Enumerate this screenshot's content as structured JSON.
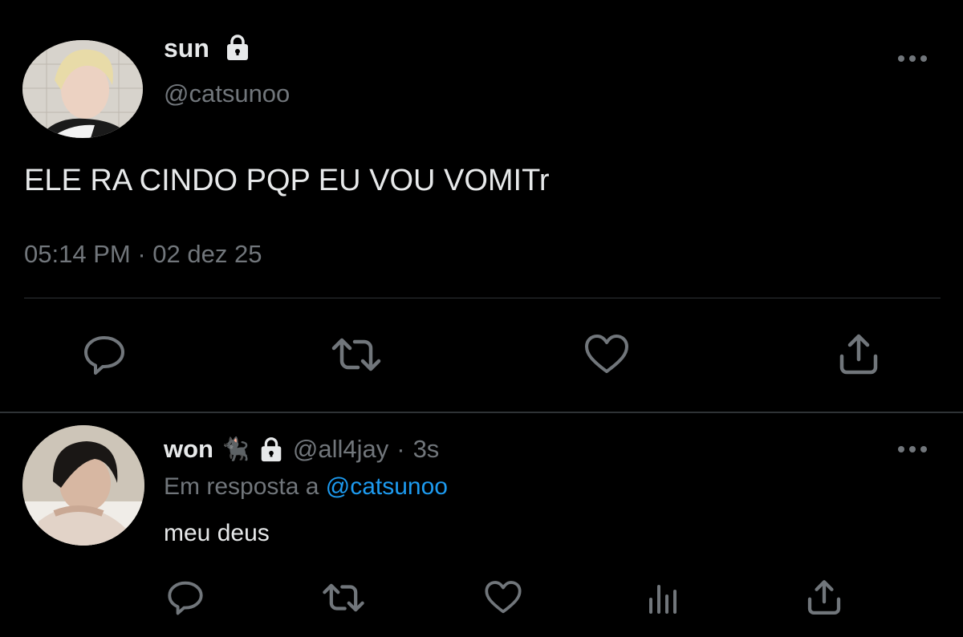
{
  "main_tweet": {
    "author": {
      "display_name": "sun",
      "handle": "@catsunoo",
      "avatar": "avatar-photo-blond",
      "locked_icon": "lock-icon"
    },
    "text": "ELE RA CINDO PQP EU VOU VOMITr",
    "time": "05:14 PM",
    "separator": "·",
    "date": "02 dez 25",
    "more_icon": "more-horizontal-icon",
    "actions": [
      {
        "icon": "reply-icon"
      },
      {
        "icon": "retweet-icon"
      },
      {
        "icon": "like-icon"
      },
      {
        "icon": "share-icon"
      }
    ]
  },
  "reply": {
    "author": {
      "display_name": "won",
      "emoji": "🐈‍⬛",
      "handle": "@all4jay",
      "avatar": "avatar-photo-dark-hair",
      "locked_icon": "lock-icon"
    },
    "separator": "·",
    "age": "3s",
    "reply_prefix": "Em resposta a",
    "reply_mention": "@catsunoo",
    "text": "meu deus",
    "more_icon": "more-horizontal-icon",
    "actions": [
      {
        "icon": "reply-icon"
      },
      {
        "icon": "retweet-icon"
      },
      {
        "icon": "like-icon"
      },
      {
        "icon": "analytics-icon"
      },
      {
        "icon": "share-icon"
      }
    ]
  },
  "colors": {
    "background": "#000000",
    "primary_text": "#e7e9ea",
    "secondary_text": "#71767b",
    "link": "#1d9bf0",
    "divider": "#2f3336",
    "icon": "#71767b"
  }
}
